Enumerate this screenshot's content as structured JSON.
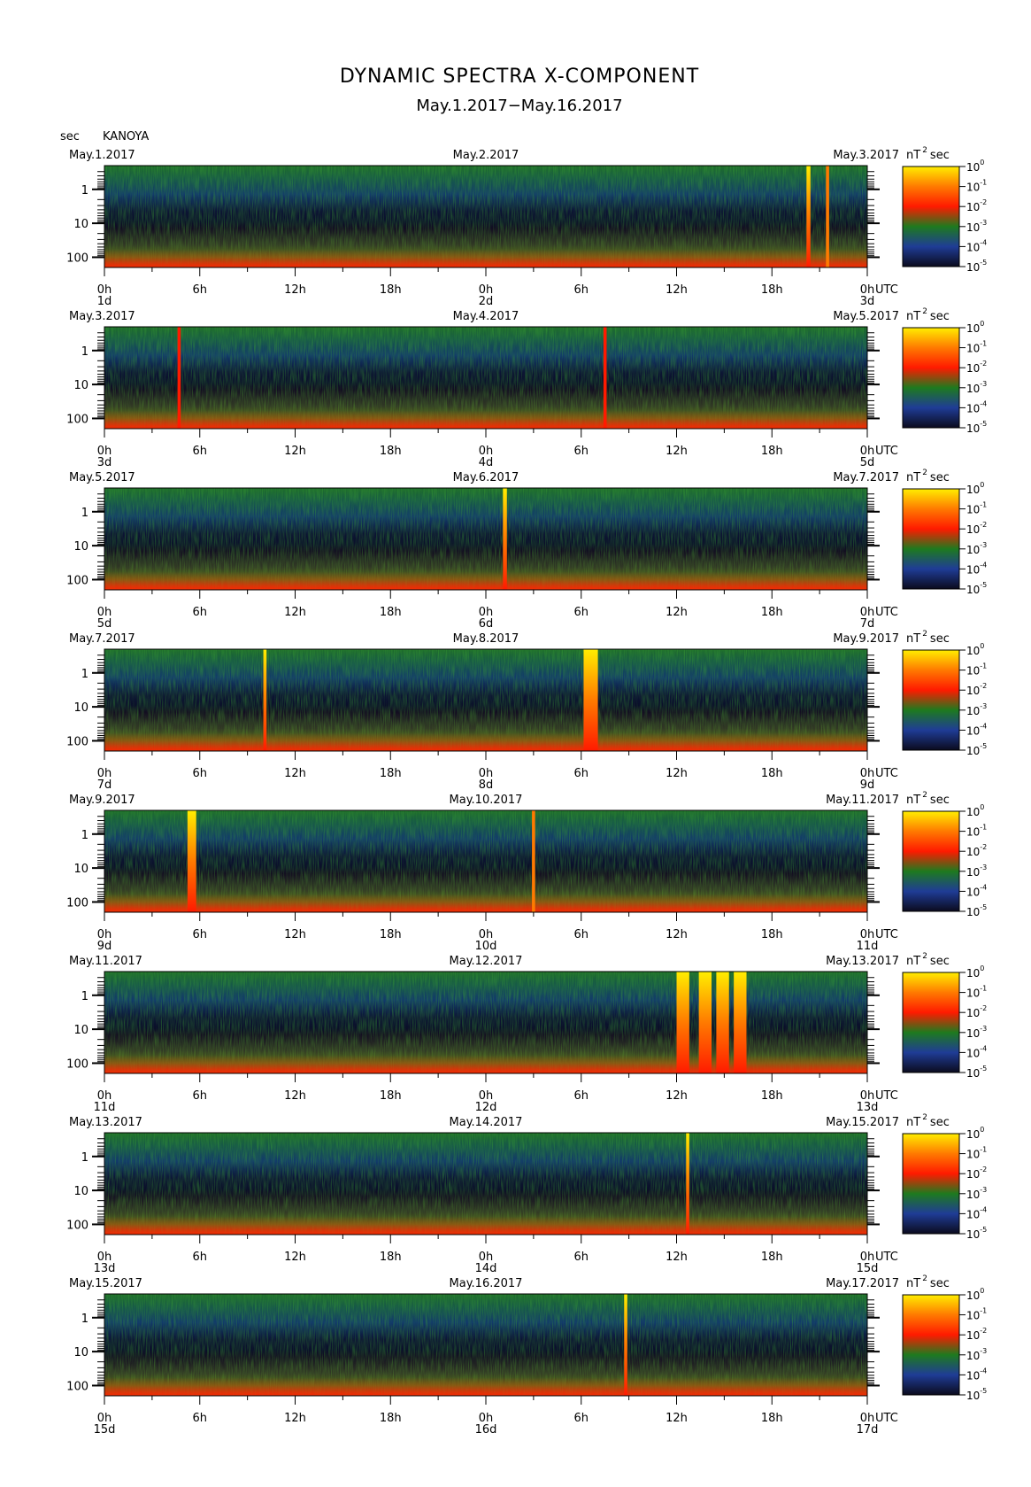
{
  "chart_data": {
    "type": "heatmap",
    "title": "DYNAMIC SPECTRA X-COMPONENT",
    "subtitle": "May.1.2017−May.16.2017",
    "station": "KANOYA",
    "y_unit": "sec",
    "y_scale": "log",
    "y_range": [
      200,
      0.2
    ],
    "y_ticks": [
      "1",
      "10",
      "100"
    ],
    "time_unit": "UTC",
    "colorbar": {
      "unit_base": "nT",
      "unit_sup": "2",
      "unit_suffix": "sec",
      "scale": "log",
      "range": [
        1e-05,
        1
      ],
      "base": "10",
      "exponents": [
        "0",
        "-1",
        "-2",
        "-3",
        "-4",
        "-5"
      ],
      "colors": [
        "#0b0b1e",
        "#1f3c96",
        "#1e7a1e",
        "#ff1a00",
        "#ff7a00",
        "#ffee00"
      ]
    },
    "hour_ticks": [
      "0h",
      "6h",
      "12h",
      "18h",
      "0h",
      "6h",
      "12h",
      "18h",
      "0h"
    ],
    "panels": [
      {
        "date_left": "May.1.2017",
        "date_mid": "May.2.2017",
        "date_right": "May.3.2017",
        "day_left": "1d",
        "day_mid": "2d",
        "day_right": "3d",
        "events": [
          {
            "t_hours": 44.3,
            "intensity_exp": -0.5,
            "width_hours": 0.25
          },
          {
            "t_hours": 45.5,
            "intensity_exp": -1.5,
            "width_hours": 0.2
          }
        ]
      },
      {
        "date_left": "May.3.2017",
        "date_mid": "May.4.2017",
        "date_right": "May.5.2017",
        "day_left": "3d",
        "day_mid": "4d",
        "day_right": "5d",
        "events": [
          {
            "t_hours": 4.7,
            "intensity_exp": -2,
            "width_hours": 0.2
          },
          {
            "t_hours": 31.5,
            "intensity_exp": -2,
            "width_hours": 0.2
          }
        ]
      },
      {
        "date_left": "May.5.2017",
        "date_mid": "May.6.2017",
        "date_right": "May.7.2017",
        "day_left": "5d",
        "day_mid": "6d",
        "day_right": "7d",
        "events": [
          {
            "t_hours": 25.2,
            "intensity_exp": -0.3,
            "width_hours": 0.25
          }
        ]
      },
      {
        "date_left": "May.7.2017",
        "date_mid": "May.8.2017",
        "date_right": "May.9.2017",
        "day_left": "7d",
        "day_mid": "8d",
        "day_right": "9d",
        "events": [
          {
            "t_hours": 10.1,
            "intensity_exp": -0.5,
            "width_hours": 0.2
          },
          {
            "t_hours": 30.6,
            "intensity_exp": -0.2,
            "width_hours": 0.9
          }
        ]
      },
      {
        "date_left": "May.9.2017",
        "date_mid": "May.10.2017",
        "date_right": "May.11.2017",
        "day_left": "9d",
        "day_mid": "10d",
        "day_right": "11d",
        "events": [
          {
            "t_hours": 5.5,
            "intensity_exp": -0.2,
            "width_hours": 0.55
          },
          {
            "t_hours": 27.0,
            "intensity_exp": -1.5,
            "width_hours": 0.2
          }
        ]
      },
      {
        "date_left": "May.11.2017",
        "date_mid": "May.12.2017",
        "date_right": "May.13.2017",
        "day_left": "11d",
        "day_mid": "12d",
        "day_right": "13d",
        "events": [
          {
            "t_hours": 36.4,
            "intensity_exp": -0.3,
            "width_hours": 0.8
          },
          {
            "t_hours": 37.8,
            "intensity_exp": -0.2,
            "width_hours": 0.8
          },
          {
            "t_hours": 38.9,
            "intensity_exp": -0.2,
            "width_hours": 0.8
          },
          {
            "t_hours": 40.0,
            "intensity_exp": -0.3,
            "width_hours": 0.8
          }
        ]
      },
      {
        "date_left": "May.13.2017",
        "date_mid": "May.14.2017",
        "date_right": "May.15.2017",
        "day_left": "13d",
        "day_mid": "14d",
        "day_right": "15d",
        "events": [
          {
            "t_hours": 36.7,
            "intensity_exp": -0.3,
            "width_hours": 0.2
          }
        ]
      },
      {
        "date_left": "May.15.2017",
        "date_mid": "May.16.2017",
        "date_right": "May.17.2017",
        "day_left": "15d",
        "day_mid": "16d",
        "day_right": "17d",
        "events": [
          {
            "t_hours": 32.8,
            "intensity_exp": -0.3,
            "width_hours": 0.2
          }
        ]
      }
    ]
  }
}
